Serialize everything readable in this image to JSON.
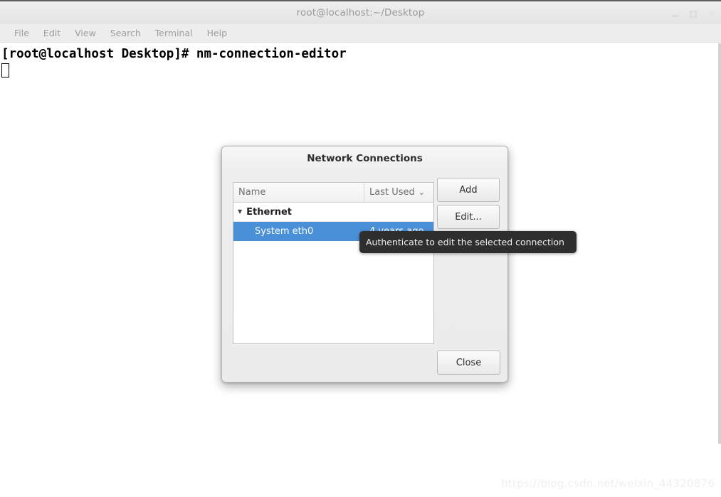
{
  "terminal": {
    "window_title": "root@localhost:~/Desktop",
    "menu": [
      {
        "label": "File"
      },
      {
        "label": "Edit"
      },
      {
        "label": "View"
      },
      {
        "label": "Search"
      },
      {
        "label": "Terminal"
      },
      {
        "label": "Help"
      }
    ],
    "window_controls": {
      "minimize": "_",
      "maximize": "□",
      "close": "✕"
    },
    "prompt_line": "[root@localhost Desktop]# nm-connection-editor"
  },
  "dialog": {
    "title": "Network Connections",
    "columns": {
      "name": "Name",
      "last_used": "Last Used",
      "sort_chevron": "⌄"
    },
    "groups": [
      {
        "expander": "▼",
        "label": "Ethernet",
        "connections": [
          {
            "name": "System eth0",
            "last_used": "4 years ago",
            "selected": true
          }
        ]
      }
    ],
    "buttons": {
      "add": "Add",
      "edit": "Edit...",
      "close": "Close"
    },
    "selection_color": "#4a90d9"
  },
  "tooltip": {
    "text": "Authenticate to edit the selected connection",
    "background": "#2e2e2e"
  },
  "watermark": {
    "text": "https://blog.csdn.net/weixin_44320876"
  }
}
